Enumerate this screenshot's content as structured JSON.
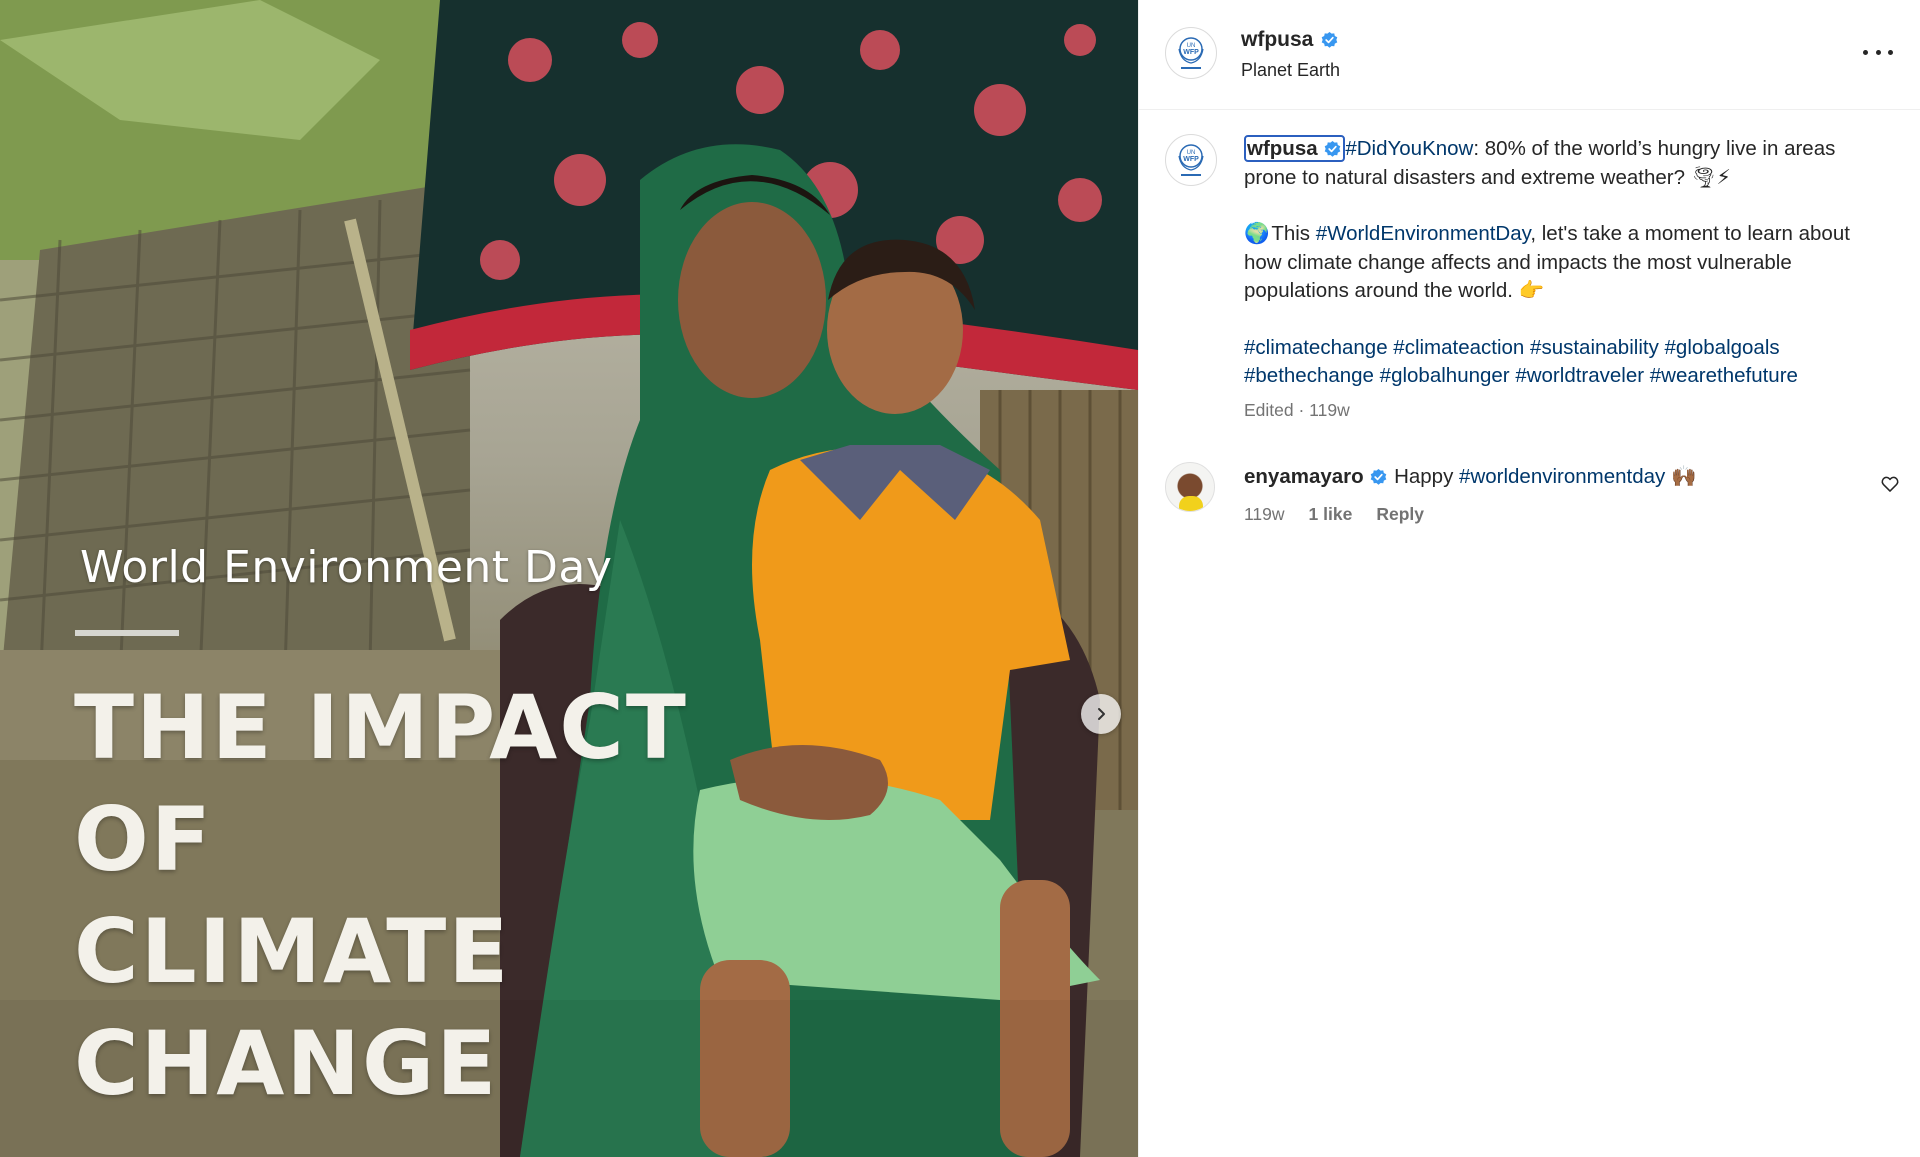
{
  "media": {
    "overlay_subtitle": "World Environment Day",
    "overlay_title_line1": "THE IMPACT OF",
    "overlay_title_line2": "CLIMATE CHANGE",
    "next_icon": "chevron-right-icon"
  },
  "header": {
    "username": "wfpusa",
    "location": "Planet Earth",
    "avatar_lines": [
      "UN",
      "WFP"
    ],
    "more_icon": "more-horizontal-icon"
  },
  "caption": {
    "username": "wfpusa",
    "hashtag_didyouknow": "#DidYouKnow",
    "line1_rest": ": 80% of the world’s hungry live in areas prone to natural disasters and extreme weather?",
    "emoji_tornado": "🌪",
    "emoji_lightning": "⚡",
    "emoji_globe": "🌍",
    "this_word": "This",
    "hashtag_wed": "#WorldEnvironmentDay",
    "line2_rest": ", let's take a moment to learn about how climate change affects and impacts the most vulnerable populations around the world.",
    "emoji_point": "👉",
    "hashtags": [
      "#climatechange",
      "#climateaction",
      "#sustainability",
      "#globalgoals",
      "#bethechange",
      "#globalhunger",
      "#worldtraveler",
      "#wearethefuture"
    ],
    "meta": "Edited · 119w"
  },
  "comment": {
    "username": "enyamayaro",
    "text_word": "Happy",
    "hashtag": "#worldenvironmentday",
    "emoji": "🙌🏾",
    "time": "119w",
    "likes": "1 like",
    "reply": "Reply",
    "heart_icon": "heart-outline-icon"
  },
  "colors": {
    "link": "#00376b",
    "verified": "#3897f0",
    "meta_gray": "#737373",
    "text": "#262626"
  }
}
